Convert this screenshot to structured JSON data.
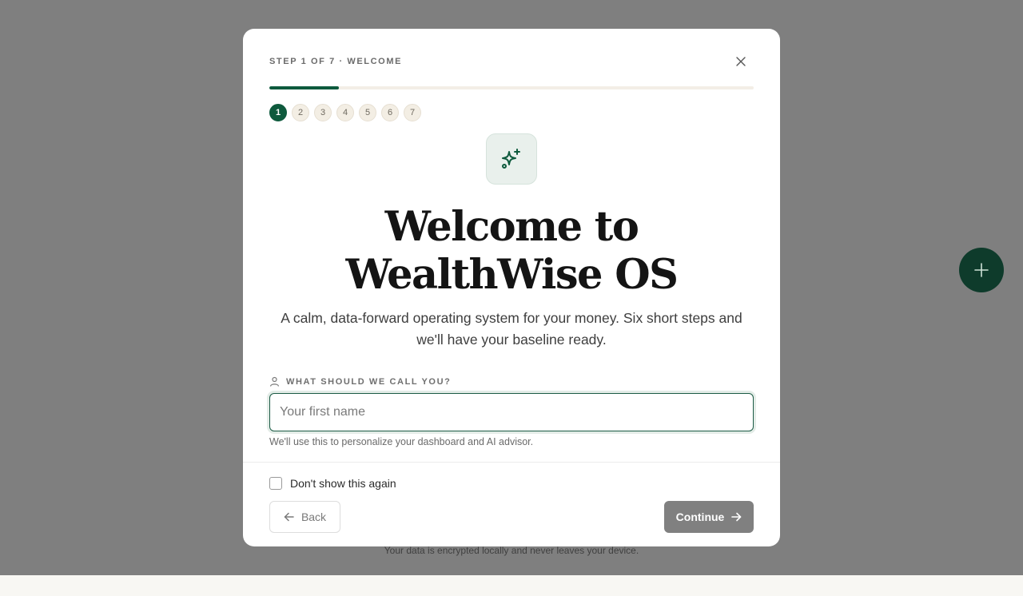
{
  "modal": {
    "step_label": "STEP 1 OF 7 · WELCOME",
    "progress": 0.143,
    "steps": [
      "1",
      "2",
      "3",
      "4",
      "5",
      "6",
      "7"
    ],
    "current_step": 1,
    "hero_icon": "sparkles-icon",
    "title": "Welcome to WealthWise OS",
    "subtitle": "A calm, data-forward operating system for your money. Six short steps and we'll have your baseline ready.",
    "name_field": {
      "label": "WHAT SHOULD WE CALL YOU?",
      "icon": "user-icon",
      "value": "",
      "placeholder": "Your first name",
      "helper": "We'll use this to personalize your dashboard and AI advisor."
    },
    "dont_show_label": "Don't show this again",
    "dont_show_checked": false,
    "back_label": "Back",
    "continue_label": "Continue"
  },
  "footnote": "Your data is encrypted locally and never leaves your device.",
  "fab_icon": "plus-icon",
  "colors": {
    "accent": "#0e5a3d",
    "fab": "#0e3b2b",
    "backdrop": "#7f7f7f",
    "continue_disabled": "#808080"
  }
}
